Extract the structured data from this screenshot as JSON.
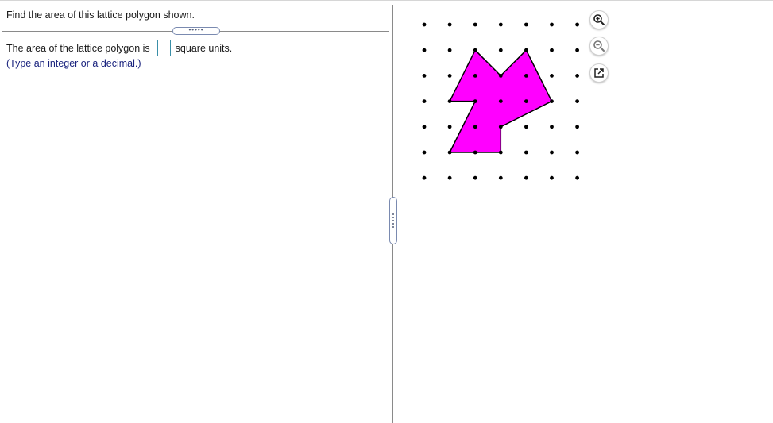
{
  "question": {
    "text": "Find the area of this lattice polygon shown."
  },
  "answer": {
    "prefix": "The area of the lattice polygon is",
    "suffix": "square units.",
    "value": "",
    "hint": "(Type an integer or a decimal.)"
  },
  "divider": {
    "handle_glyph": "•••••"
  },
  "lattice": {
    "cols": 7,
    "rows": 7,
    "polygon_vertices": [
      [
        2,
        1
      ],
      [
        3,
        2
      ],
      [
        4,
        1
      ],
      [
        5,
        3
      ],
      [
        3,
        4
      ],
      [
        3,
        5
      ],
      [
        1,
        5
      ],
      [
        2,
        3
      ],
      [
        1,
        3
      ]
    ],
    "fill_color": "#ff00ff",
    "stroke_color": "#000000"
  },
  "tools": [
    {
      "name": "zoom-in-icon"
    },
    {
      "name": "zoom-out-icon"
    },
    {
      "name": "popout-icon"
    }
  ]
}
